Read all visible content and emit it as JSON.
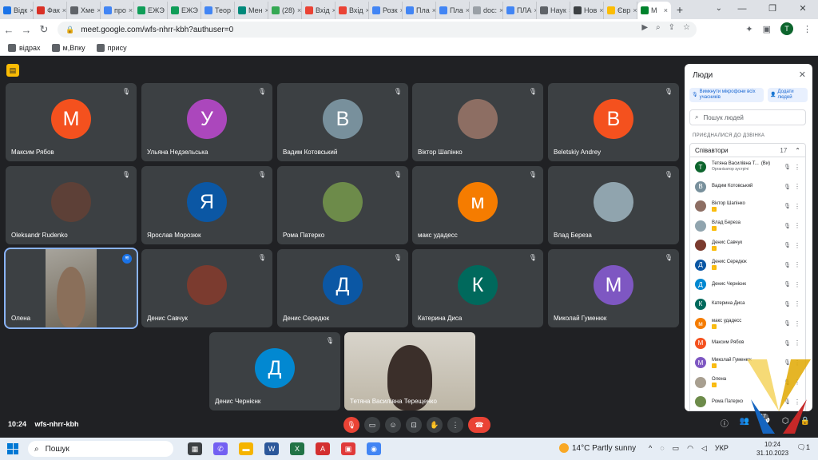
{
  "tabs": [
    {
      "label": "Відк",
      "color": "#1a73e8"
    },
    {
      "label": "Фак",
      "color": "#d93025"
    },
    {
      "label": "Хме",
      "color": "#5f6368"
    },
    {
      "label": "про",
      "color": "#4285f4"
    },
    {
      "label": "ЕЖЭ",
      "color": "#0f9d58"
    },
    {
      "label": "ЕЖЭ",
      "color": "#0f9d58"
    },
    {
      "label": "Теор",
      "color": "#4285f4"
    },
    {
      "label": "Мен",
      "color": "#00897b"
    },
    {
      "label": "(28)",
      "color": "#34a853"
    },
    {
      "label": "Вхід",
      "color": "#ea4335"
    },
    {
      "label": "Вхід",
      "color": "#ea4335"
    },
    {
      "label": "Розк",
      "color": "#4285f4"
    },
    {
      "label": "Пла",
      "color": "#4285f4"
    },
    {
      "label": "Пла",
      "color": "#4285f4"
    },
    {
      "label": "doc:",
      "color": "#9aa0a6"
    },
    {
      "label": "ПЛА",
      "color": "#4285f4"
    },
    {
      "label": "Наук",
      "color": "#5f6368"
    },
    {
      "label": "Нов",
      "color": "#3c4043"
    },
    {
      "label": "Євр",
      "color": "#fbbc04"
    },
    {
      "label": "M",
      "color": "#00832d"
    }
  ],
  "url": "meet.google.com/wfs-nhrr-kbh?authuser=0",
  "profile_letter": "T",
  "bookmarks": [
    "відрах",
    "м,Впку",
    "прису"
  ],
  "badge_icon": "presentation-icon",
  "tiles": [
    {
      "name": "Максим Рябов",
      "letter": "М",
      "color": "#f4511e",
      "muted": true
    },
    {
      "name": "Ульяна Недзельська",
      "letter": "У",
      "color": "#ab47bc",
      "muted": true
    },
    {
      "name": "Вадим Котовський",
      "letter": "В",
      "color": "#78909c",
      "muted": true
    },
    {
      "name": "Віктор Шапінко",
      "letter": "",
      "color": "#8d6e63",
      "muted": true,
      "photo": true
    },
    {
      "name": "Beletskiy Andrey",
      "letter": "В",
      "color": "#f4511e",
      "muted": true
    },
    {
      "name": "Oleksandr Rudenko",
      "letter": "",
      "color": "#5d4037",
      "muted": true,
      "photo": true
    },
    {
      "name": "Ярослав Морозюк",
      "letter": "Я",
      "color": "#0b57a4",
      "muted": true
    },
    {
      "name": "Рома Патерко",
      "letter": "",
      "color": "#6d8b4a",
      "muted": true,
      "photo": true
    },
    {
      "name": "макс удадесс",
      "letter": "м",
      "color": "#f57c00",
      "muted": true
    },
    {
      "name": "Влад Береза",
      "letter": "",
      "color": "#90a4ae",
      "muted": true,
      "photo": true
    },
    {
      "name": "Олена",
      "letter": "",
      "color": "#a89f90",
      "muted": false,
      "video": true
    },
    {
      "name": "Денис Савчук",
      "letter": "",
      "color": "#7b3b2f",
      "muted": true,
      "photo": true
    },
    {
      "name": "Денис Середюк",
      "letter": "Д",
      "color": "#0b57a4",
      "muted": true
    },
    {
      "name": "Катерина Диса",
      "letter": "К",
      "color": "#00695c",
      "muted": true
    },
    {
      "name": "Миколай Гуменюк",
      "letter": "М",
      "color": "#7e57c2",
      "muted": true
    },
    {
      "name": "Денис Чернієнк",
      "letter": "Д",
      "color": "#0288d1",
      "muted": true
    },
    {
      "name": "Тетяна Василівна Терещенко",
      "letter": "",
      "color": "#c9c3b5",
      "muted": false,
      "video": true
    }
  ],
  "meeting": {
    "time": "10:24",
    "code": "wfs-nhrr-kbh",
    "participants_count": "17"
  },
  "panel": {
    "title": "Люди",
    "mute_all_label": "Вимкнути мікрофони всіх учасників",
    "add_people_label": "Додати людей",
    "search_placeholder": "Пошук людей",
    "section_label": "ПРИЄДНАЛИСЯ ДО ДЗВІНКА",
    "group_label": "Співавтори",
    "group_count": "17",
    "people": [
      {
        "name": "Тетяна Василівна Т...",
        "suffix": "(Ви)",
        "sub": "Організатор зустрічі",
        "letter": "Т",
        "color": "#0d652d"
      },
      {
        "name": "Вадим Котовський",
        "letter": "В",
        "color": "#78909c"
      },
      {
        "name": "Віктор Шапінко",
        "letter": "",
        "color": "#8d6e63",
        "hand": true
      },
      {
        "name": "Влад Береза",
        "letter": "",
        "color": "#90a4ae",
        "hand": true
      },
      {
        "name": "Денис Савчук",
        "letter": "",
        "color": "#7b3b2f",
        "hand": true
      },
      {
        "name": "Денис Середюк",
        "letter": "Д",
        "color": "#0b57a4",
        "hand": true
      },
      {
        "name": "Денис Чернієнк",
        "letter": "Д",
        "color": "#0288d1"
      },
      {
        "name": "Катерина Диса",
        "letter": "К",
        "color": "#00695c"
      },
      {
        "name": "макс удадесс",
        "letter": "м",
        "color": "#f57c00",
        "hand": true
      },
      {
        "name": "Максим Рябов",
        "letter": "М",
        "color": "#f4511e"
      },
      {
        "name": "Миколай Гуменюк",
        "letter": "М",
        "color": "#7e57c2",
        "hand": true
      },
      {
        "name": "Олена",
        "letter": "",
        "color": "#a89f90",
        "hand": true
      },
      {
        "name": "Рома Патерко",
        "letter": "",
        "color": "#6d8b4a"
      }
    ]
  },
  "taskbar": {
    "search_label": "Пошук",
    "weather": "14°C Partly sunny",
    "lang": "УКР",
    "time": "10:24",
    "date": "31.10.2023",
    "notif_count": "1"
  }
}
